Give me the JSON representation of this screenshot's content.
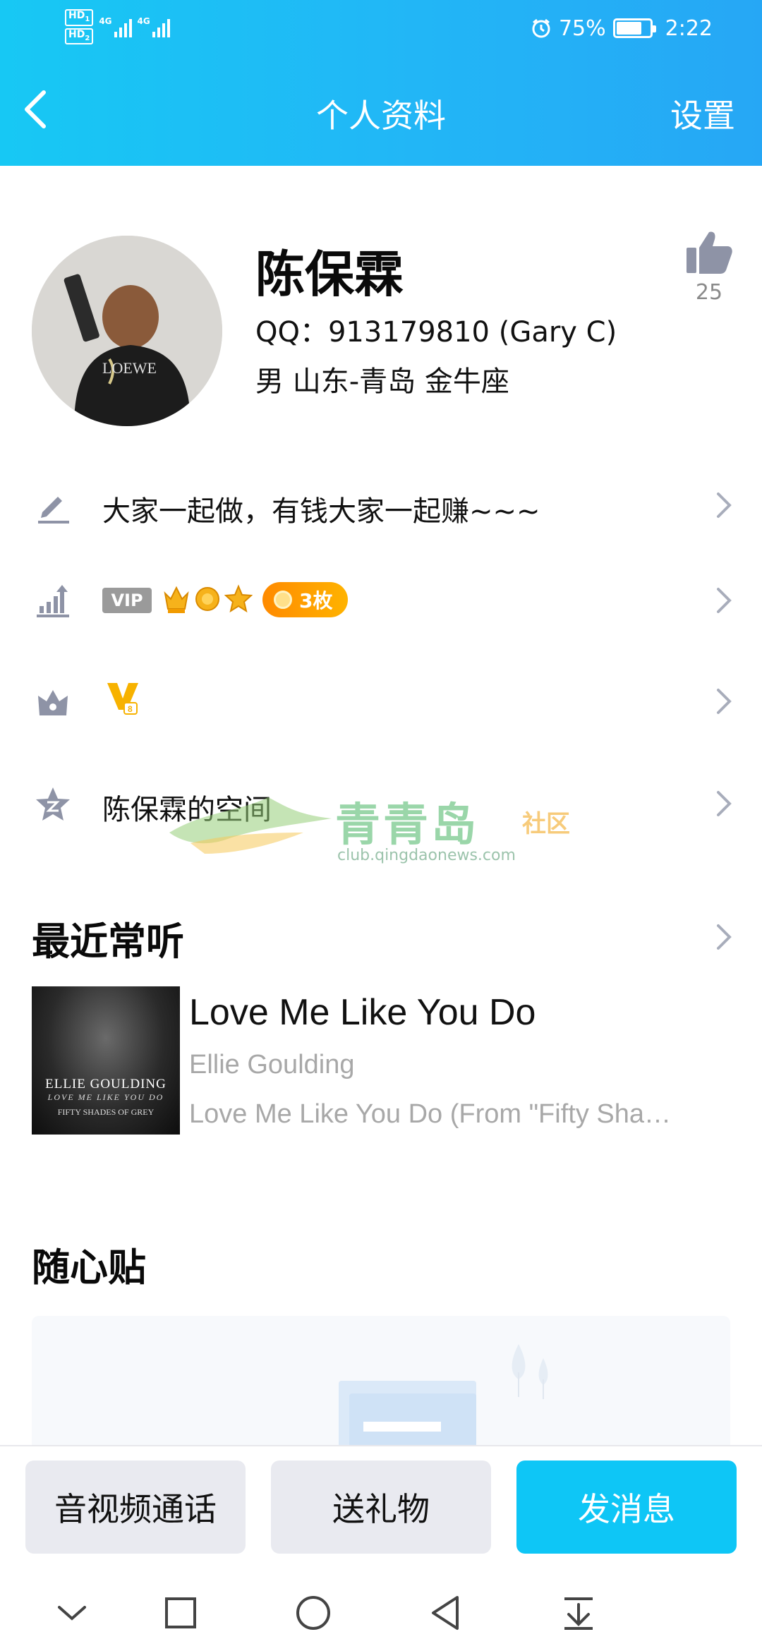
{
  "status_bar": {
    "hd1": "HD",
    "hd1_sub": "1",
    "hd2": "HD",
    "hd2_sub": "2",
    "signal1_label": "4G",
    "signal2_label": "4G",
    "battery_percent": "75%",
    "battery_level": 0.75,
    "time": "2:22",
    "alarm_icon": "alarm-clock-icon"
  },
  "header": {
    "title": "个人资料",
    "settings_label": "设置",
    "back_icon": "back-arrow-icon",
    "background": "#1fbdf5"
  },
  "profile": {
    "name": "陈保霖",
    "qq_line": "QQ：913179810 (Gary C)",
    "meta_line": "男  山东-青岛  金牛座",
    "like_count": "25",
    "like_icon": "thumbs-up-icon"
  },
  "rows": {
    "signature": {
      "icon": "pencil-icon",
      "text": "大家一起做，有钱大家一起赚~~~"
    },
    "level": {
      "icon": "level-chart-icon",
      "vip_label": "VIP",
      "medals_count": "3枚"
    },
    "vip": {
      "icon": "crown-box-icon",
      "badge_icon": "vip-v-badge-icon"
    },
    "space": {
      "icon": "qzone-star-icon",
      "text": "陈保霖的空间"
    }
  },
  "watermark": {
    "brand": "青青岛",
    "tag": "社区",
    "url": "club.qingdaonews.com"
  },
  "recent": {
    "section_title": "最近常听",
    "album_line1": "ELLIE GOULDING",
    "album_line2": "LOVE ME LIKE YOU DO",
    "album_line3": "FIFTY SHADES OF GREY",
    "song_title": "Love Me Like You Do",
    "artist": "Ellie Goulding",
    "album": "Love Me Like You Do (From \"Fifty Sha…"
  },
  "stickers": {
    "section_title": "随心贴"
  },
  "actions": {
    "call_label": "音视频通话",
    "gift_label": "送礼物",
    "message_label": "发消息",
    "accent": "#0ec6f6"
  },
  "navbar": {
    "icons": [
      "chevron-down-icon",
      "square-icon",
      "circle-home-icon",
      "triangle-back-icon",
      "download-icon"
    ]
  }
}
